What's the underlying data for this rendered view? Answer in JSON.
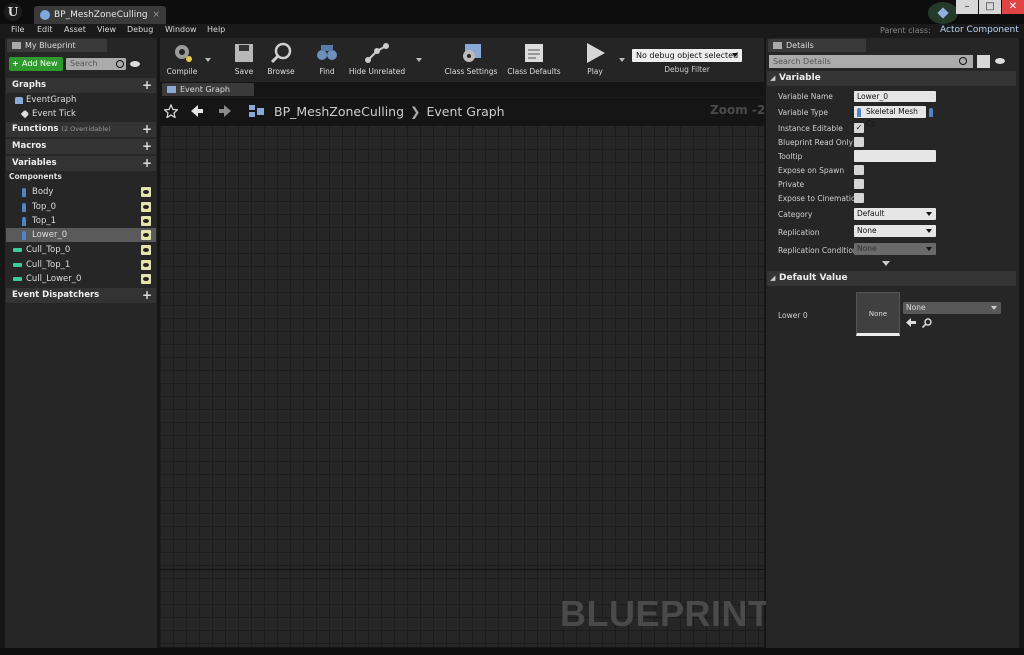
{
  "titlebar": {
    "tab": "BP_MeshZoneCulling",
    "close": "×",
    "logo": "U",
    "minimize": "–",
    "maximize": "□",
    "window_close": "✕"
  },
  "menu": [
    "File",
    "Edit",
    "Asset",
    "View",
    "Debug",
    "Window",
    "Help"
  ],
  "parent_class": {
    "label": "Parent class:",
    "value": "Actor Component"
  },
  "my_blueprint": {
    "tab": "My Blueprint",
    "add_new": "Add New",
    "search_placeholder": "Search",
    "graphs": "Graphs",
    "event_graph": "EventGraph",
    "event_tick": "Event Tick",
    "functions": "Functions",
    "functions_sub": "(2 Overridable)",
    "macros": "Macros",
    "variables": "Variables",
    "components": "Components",
    "component_items": [
      "Body",
      "Top_0",
      "Top_1",
      "Lower_0"
    ],
    "cull_items": [
      "Cull_Top_0",
      "Cull_Top_1",
      "Cull_Lower_0"
    ],
    "event_dispatchers": "Event Dispatchers"
  },
  "toolbar": {
    "compile": "Compile",
    "save": "Save",
    "browse": "Browse",
    "find": "Find",
    "hide_unrelated": "Hide Unrelated",
    "class_settings": "Class Settings",
    "class_defaults": "Class Defaults",
    "play": "Play",
    "debug_select": "No debug object selected",
    "debug_filter": "Debug Filter"
  },
  "graph": {
    "tab": "Event Graph",
    "crumb_root": "BP_MeshZoneCulling",
    "crumb_sep": "❯",
    "crumb_leaf": "Event Graph",
    "zoom": "Zoom -2",
    "watermark": "BLUEPRINT"
  },
  "details": {
    "tab": "Details",
    "search_placeholder": "Search Details",
    "variable_section": "Variable",
    "props": {
      "variable_name_label": "Variable Name",
      "variable_name": "Lower_0",
      "variable_type_label": "Variable Type",
      "variable_type": "Skeletal Mesh Co",
      "instance_editable": "Instance Editable",
      "read_only": "Blueprint Read Only",
      "tooltip": "Tooltip",
      "expose_spawn": "Expose on Spawn",
      "private": "Private",
      "expose_cine": "Expose to Cinematics",
      "category_label": "Category",
      "category": "Default",
      "replication_label": "Replication",
      "replication": "None",
      "rep_cond_label": "Replication Condition",
      "rep_cond": "None"
    },
    "default_section": "Default Value",
    "default_label": "Lower 0",
    "thumb": "None",
    "default_select": "None",
    "check": "✓"
  }
}
